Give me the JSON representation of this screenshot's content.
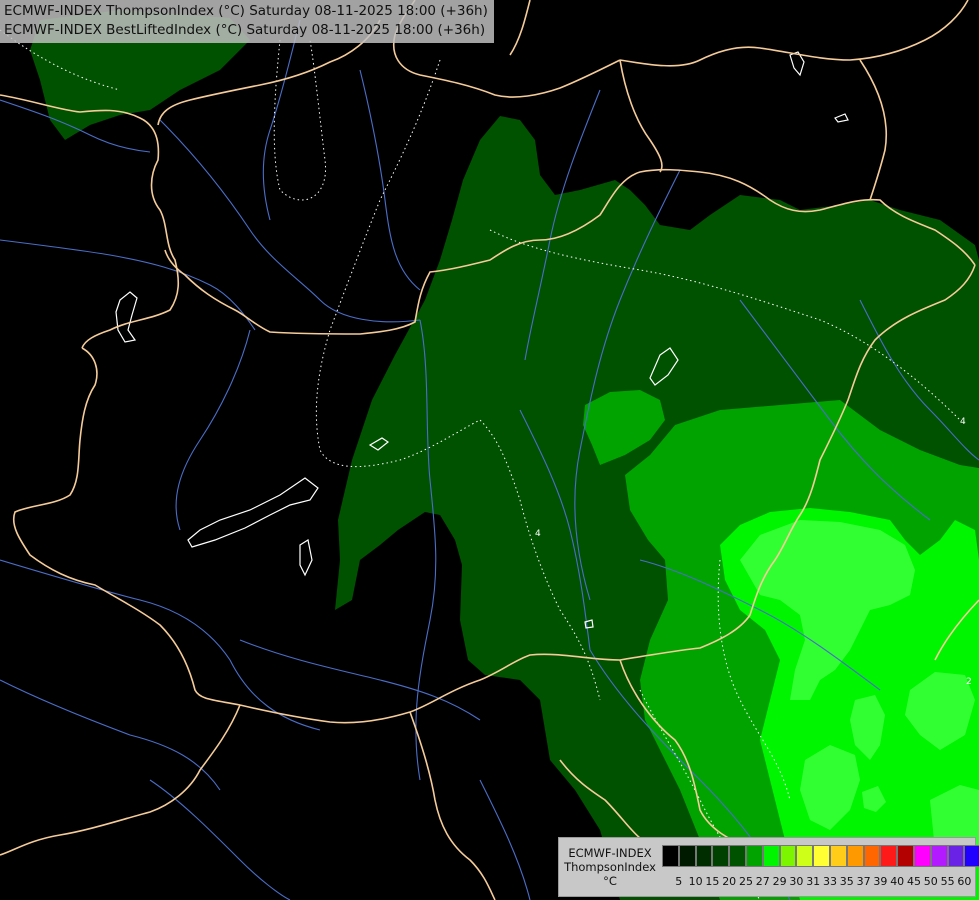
{
  "header": {
    "line1": "ECMWF-INDEX ThompsonIndex (°C) Saturday 08-11-2025 18:00 (+36h)",
    "line2": "ECMWF-INDEX BestLiftedIndex (°C) Saturday 08-11-2025 18:00 (+36h)"
  },
  "map": {
    "field_colors": {
      "background": "#000000",
      "level_25": "#005100",
      "level_27": "#00a300",
      "level_29": "#00f500",
      "level_30": "#32ff32"
    },
    "contour_labels": [
      "4",
      "2",
      "4"
    ],
    "border_color": "#f5cc99",
    "river_color": "#4a6ec8",
    "isoline_color": "#ffffff"
  },
  "legend": {
    "title_lines": [
      "ECMWF-INDEX",
      "ThompsonIndex",
      "°C"
    ],
    "ticks": [
      "5",
      "10",
      "15",
      "20",
      "25",
      "27",
      "29",
      "30",
      "31",
      "33",
      "35",
      "37",
      "39",
      "40",
      "45",
      "50",
      "55",
      "60"
    ],
    "colors": [
      "#000000",
      "#001a00",
      "#002d00",
      "#004000",
      "#005100",
      "#00a300",
      "#00f500",
      "#7cf500",
      "#cdff19",
      "#ffff33",
      "#ffcc1a",
      "#ff9900",
      "#ff6600",
      "#ff1a1a",
      "#b30000",
      "#ff00ff",
      "#b31aff",
      "#6a23e6",
      "#2200ff"
    ]
  }
}
